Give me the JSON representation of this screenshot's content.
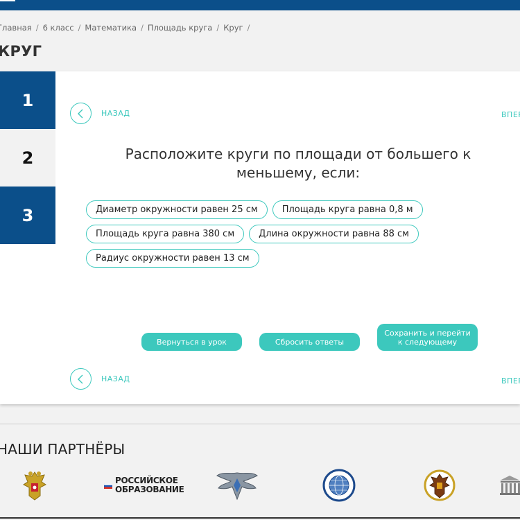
{
  "breadcrumb": {
    "items": [
      "Главная",
      "6 класс",
      "Математика",
      "Площадь круга",
      "Круг"
    ],
    "separator": "/"
  },
  "page_title": "КРУГ",
  "steps": [
    {
      "label": "1",
      "style": "dark"
    },
    {
      "label": "2",
      "style": "light"
    },
    {
      "label": "3",
      "style": "dark"
    }
  ],
  "nav": {
    "back_label": "НАЗАД",
    "forward_label": "ВПЕР"
  },
  "question": "Расположите круги по площади от большего к меньшему, если:",
  "options": [
    [
      "Диаметр окружности равен 25 см",
      "Площадь круга равна 0,8 м"
    ],
    [
      "Площадь круга равна 380 см",
      "Длина окружности равна 88 см"
    ],
    [
      "Радиус окружности равен 13 см"
    ]
  ],
  "buttons": {
    "back_to_lesson": "Вернуться в урок",
    "reset_answers": "Сбросить ответы",
    "save_next": "Сохранить и перейти к следующему"
  },
  "partners": {
    "title": "НАШИ ПАРТНЁРЫ",
    "ro_logo": {
      "line1": "РОССИЙСКОЕ",
      "line2": "ОБРАЗОВАНИЕ"
    },
    "logo_icons": [
      "emblem-eagle-icon",
      "russian-flag-icon",
      "ministry-emblem-icon",
      "geographic-society-globe-icon",
      "mchs-emblem-icon",
      "building-icon"
    ]
  },
  "colors": {
    "header_blue": "#0b4f8a",
    "accent_teal": "#3cc8bd",
    "page_bg": "#f2f2f2"
  }
}
